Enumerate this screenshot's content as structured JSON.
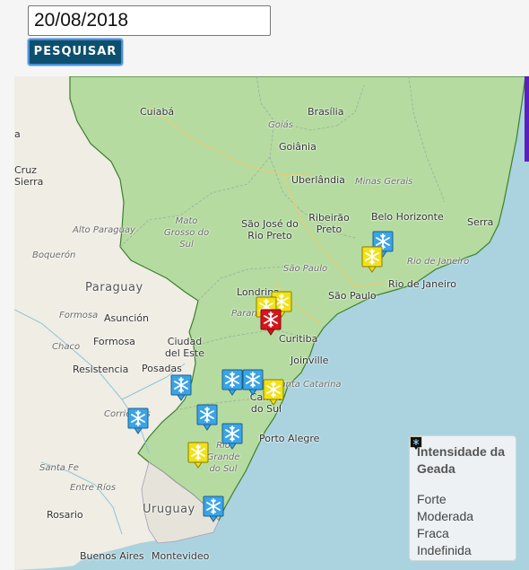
{
  "search": {
    "date_value": "20/08/2018",
    "button_label": "PESQUISAR"
  },
  "map": {
    "countries": [
      "Paraguay",
      "Uruguay"
    ],
    "states": [
      "Goiás",
      "Minas Gerais",
      "Mato Grosso do Sul",
      "Alto Paraguay",
      "Boquerón",
      "São Paulo",
      "Paraná",
      "Formosa",
      "Chaco",
      "Corrientes",
      "Santa Fe",
      "Entre Ríos",
      "Santa Catarina",
      "Rio Grande do Sul",
      "Rio de Janeiro"
    ],
    "cities": [
      "Cuiabá",
      "Brasília",
      "Goiânia",
      "Uberlândia",
      "São José do Rio Preto",
      "Ribeirão Preto",
      "Belo Horizonte",
      "Serra",
      "Cruz Sierra",
      "Londrina",
      "São Paulo",
      "Rio de Janeiro",
      "Asunción",
      "Formosa",
      "Ciudad del Este",
      "Curitiba",
      "Joinville",
      "Posadas",
      "Resistencia",
      "Caxias do Sul",
      "Porto Alegre",
      "Rosario",
      "Buenos Aires",
      "Montevideo"
    ],
    "partial_labels": [
      "a"
    ]
  },
  "legend": {
    "title": "Intensidade da Geada",
    "items": [
      {
        "label": "Forte",
        "color": "#d9141c"
      },
      {
        "label": "Moderada",
        "color": "#f2e118"
      },
      {
        "label": "Fraca",
        "color": "#3aa4e6"
      },
      {
        "label": "Indefinida",
        "color": "#111111"
      }
    ]
  },
  "colors": {
    "region_fill": "#b5dba0",
    "land": "#efede4",
    "water": "#aad3df",
    "accent": "#5c1fbf"
  },
  "markers": [
    {
      "intensity": "Fraca",
      "icon": "snowflake-icon"
    },
    {
      "intensity": "Moderada",
      "icon": "snowflake-icon"
    },
    {
      "intensity": "Moderada",
      "icon": "snowflake-icon"
    },
    {
      "intensity": "Moderada",
      "icon": "snowflake-icon"
    },
    {
      "intensity": "Forte",
      "icon": "snowflake-icon"
    },
    {
      "intensity": "Fraca",
      "icon": "snowflake-icon"
    },
    {
      "intensity": "Fraca",
      "icon": "snowflake-icon"
    },
    {
      "intensity": "Fraca",
      "icon": "snowflake-icon"
    },
    {
      "intensity": "Moderada",
      "icon": "snowflake-icon"
    },
    {
      "intensity": "Fraca",
      "icon": "snowflake-icon"
    },
    {
      "intensity": "Fraca",
      "icon": "snowflake-icon"
    },
    {
      "intensity": "Fraca",
      "icon": "snowflake-icon"
    },
    {
      "intensity": "Moderada",
      "icon": "snowflake-icon"
    },
    {
      "intensity": "Fraca",
      "icon": "snowflake-icon"
    }
  ]
}
